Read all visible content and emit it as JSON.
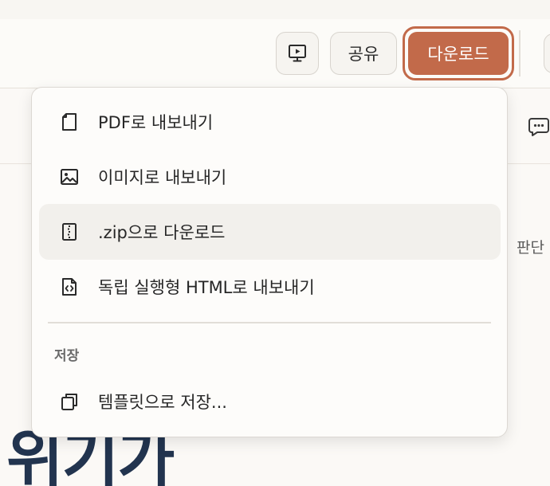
{
  "toolbar": {
    "share_label": "공유",
    "download_label": "다운로드"
  },
  "background": {
    "partial_text": "판단",
    "heading": "위기가"
  },
  "menu": {
    "items": [
      {
        "label": "PDF로 내보내기",
        "icon": "pdf-file-icon"
      },
      {
        "label": "이미지로 내보내기",
        "icon": "image-icon"
      },
      {
        "label": ".zip으로 다운로드",
        "icon": "zip-file-icon"
      },
      {
        "label": "독립 실행형 HTML로 내보내기",
        "icon": "html-file-icon"
      }
    ],
    "save_section": {
      "header": "저장",
      "items": [
        {
          "label": "템플릿으로 저장...",
          "icon": "copy-template-icon"
        }
      ]
    }
  },
  "colors": {
    "accent": "#c26a4a",
    "heading": "#22344f",
    "hover": "#f2f0ec"
  }
}
